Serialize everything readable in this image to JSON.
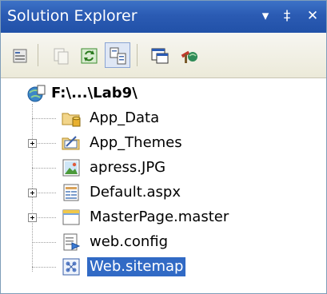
{
  "window": {
    "title": "Solution Explorer",
    "buttons": {
      "dropdown": "▾",
      "pin": "‡",
      "close": "✕"
    }
  },
  "toolbar": {
    "tools": [
      {
        "name": "properties-icon",
        "active": false
      },
      {
        "name": "show-all-files-icon",
        "active": false
      },
      {
        "name": "refresh-icon",
        "active": false
      },
      {
        "name": "nest-related-files-icon",
        "active": true
      },
      {
        "name": "view-designer-icon",
        "active": false
      },
      {
        "name": "copy-web-site-icon",
        "active": false
      }
    ]
  },
  "tree": {
    "root": {
      "label": "F:\\...\\Lab9\\",
      "icon": "web-project-icon"
    },
    "items": [
      {
        "label": "App_Data",
        "icon": "special-folder-icon",
        "expandable": false,
        "selected": false
      },
      {
        "label": "App_Themes",
        "icon": "themes-folder-icon",
        "expandable": true,
        "selected": false
      },
      {
        "label": "apress.JPG",
        "icon": "image-file-icon",
        "expandable": false,
        "selected": false
      },
      {
        "label": "Default.aspx",
        "icon": "aspx-file-icon",
        "expandable": true,
        "selected": false
      },
      {
        "label": "MasterPage.master",
        "icon": "master-page-icon",
        "expandable": true,
        "selected": false
      },
      {
        "label": "web.config",
        "icon": "config-file-icon",
        "expandable": false,
        "selected": false
      },
      {
        "label": "Web.sitemap",
        "icon": "sitemap-file-icon",
        "expandable": false,
        "selected": true
      }
    ]
  }
}
